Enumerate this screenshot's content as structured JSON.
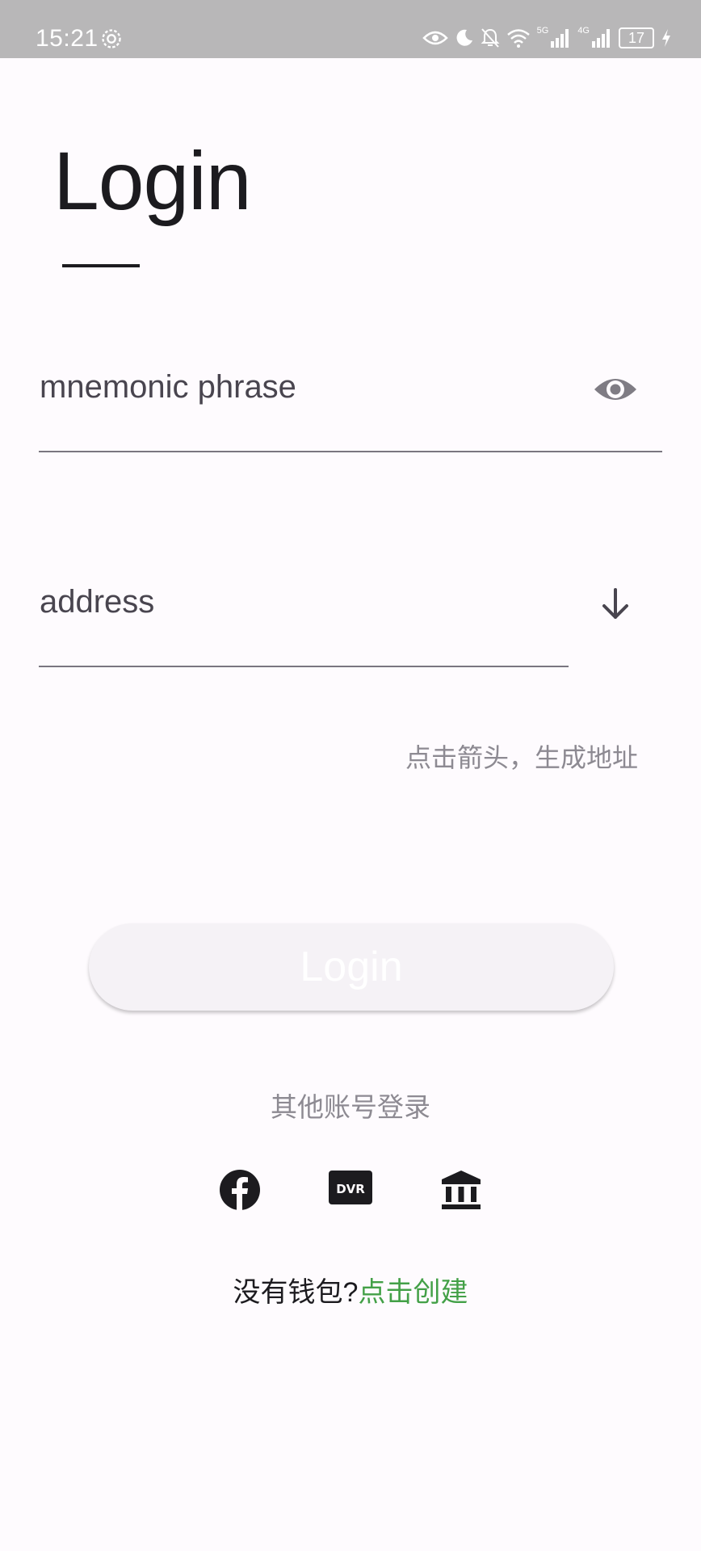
{
  "status_bar": {
    "time": "15:21",
    "network_1": "5G",
    "network_2": "4G",
    "battery": "17",
    "icons": [
      "settings-icon",
      "eye-icon",
      "moon-icon",
      "bell-off-icon",
      "wifi-icon",
      "signal-icon",
      "signal-icon",
      "battery-icon",
      "charging-icon"
    ]
  },
  "page": {
    "title": "Login"
  },
  "form": {
    "mnemonic_label": "mnemonic phrase",
    "mnemonic_icon": "eye-icon",
    "address_label": "address",
    "address_icon": "arrow-down-icon",
    "hint": "点击箭头，生成地址",
    "login_button": "Login"
  },
  "alt_login": {
    "label": "其他账号登录",
    "providers": [
      "facebook-icon",
      "dvr-icon",
      "bank-icon"
    ]
  },
  "footer": {
    "prompt": "没有钱包?",
    "link": "点击创建"
  },
  "colors": {
    "background": "#fefbfe",
    "status_bar": "#b8b7b8",
    "link": "#43a047",
    "muted_text": "#8d8a92"
  }
}
